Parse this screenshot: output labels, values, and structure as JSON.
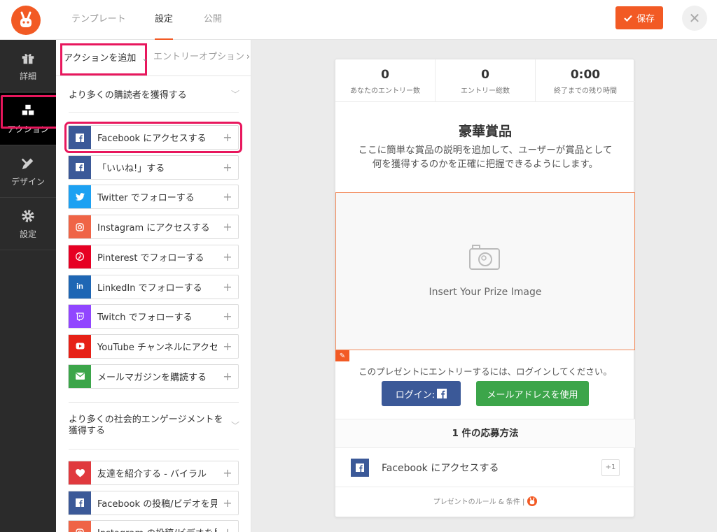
{
  "topbar": {
    "tabs": [
      "テンプレート",
      "設定",
      "公開"
    ],
    "active_tab": "設定",
    "save_label": "保存",
    "close_label": "✕"
  },
  "rail": {
    "items": [
      {
        "label": "詳細",
        "icon": "gift-icon"
      },
      {
        "label": "アクション",
        "icon": "cubes-icon"
      },
      {
        "label": "デザイン",
        "icon": "design-tools-icon"
      },
      {
        "label": "設定",
        "icon": "gear-icon"
      }
    ],
    "active": "アクション"
  },
  "panel": {
    "subtab_active": "アクションを追加",
    "subtab_2": "エントリーオプション",
    "section1": "より多くの購読者を獲得する",
    "section2": "より多くの社会的エンゲージメントを獲得する",
    "actions1": [
      {
        "label": "Facebook にアクセスする",
        "icon": "facebook-icon",
        "color": "#3b5998"
      },
      {
        "label": "「いいね!」する",
        "icon": "facebook-icon",
        "color": "#3b5998"
      },
      {
        "label": "Twitter でフォローする",
        "icon": "twitter-icon",
        "color": "#1da1f2"
      },
      {
        "label": "Instagram にアクセスする",
        "icon": "instagram-icon",
        "color": "#ef6446"
      },
      {
        "label": "Pinterest でフォローする",
        "icon": "pinterest-icon",
        "color": "#e60023"
      },
      {
        "label": "LinkedIn でフォローする",
        "icon": "linkedin-icon",
        "color": "#1e66b4"
      },
      {
        "label": "Twitch でフォローする",
        "icon": "twitch-icon",
        "color": "#9146ff"
      },
      {
        "label": "YouTube チャンネルにアクセスする",
        "icon": "youtube-icon",
        "color": "#e62117"
      },
      {
        "label": "メールマガジンを購読する",
        "icon": "envelope-icon",
        "color": "#3ca54a"
      }
    ],
    "actions2": [
      {
        "label": "友達を紹介する - バイラル",
        "icon": "heart-icon",
        "color": "#e0393e"
      },
      {
        "label": "Facebook の投稿/ビデオを見る",
        "icon": "facebook-icon",
        "color": "#3b5998"
      },
      {
        "label": "Instagram の投稿/ビデオを見る",
        "icon": "instagram-icon",
        "color": "#ef6446"
      }
    ]
  },
  "preview": {
    "stats": [
      {
        "num": "0",
        "cap": "あなたのエントリー数"
      },
      {
        "num": "0",
        "cap": "エントリー総数"
      },
      {
        "num": "0:00",
        "cap": "終了までの残り時間"
      }
    ],
    "prize_title": "豪華賞品",
    "prize_desc": "ここに簡単な賞品の説明を追加して、ユーザーが賞品として何を獲得するのかを正確に把握できるようにします。",
    "image_placeholder": "Insert Your Prize Image",
    "login_text": "このプレゼントにエントリーするには、ログインしてください。",
    "login_fb": "ログイン:",
    "login_mail": "メールアドレスを使用",
    "methods_head": "1 件の応募方法",
    "method_label": "Facebook にアクセスする",
    "method_points": "+1",
    "footer": "プレゼントのルール & 条件 |"
  }
}
